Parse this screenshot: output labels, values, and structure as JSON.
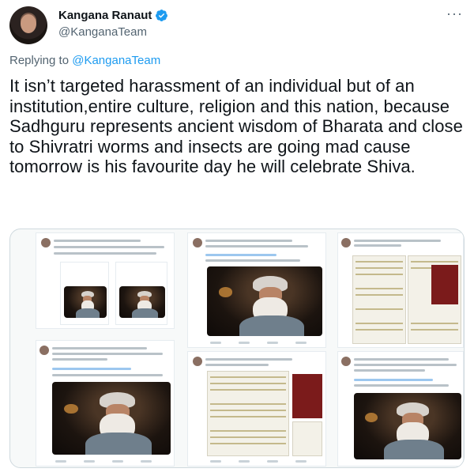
{
  "author": {
    "name": "Kangana Ranaut",
    "handle": "@KanganaTeam",
    "verified": true,
    "more_icon": "more-horizontal-icon"
  },
  "replying": {
    "prefix": "Replying to",
    "handle": "@KanganaTeam"
  },
  "tweet": {
    "text": "It isn’t targeted harassment of an individual but of an institution,entire culture, religion and this nation, because Sadhguru represents ancient wisdom of Bharata and close to Shivratri worms and insects are going mad cause tomorrow is his favourite day he will celebrate Shiva."
  },
  "colors": {
    "link": "#1d9bf0",
    "verified_badge": "#1d9bf0",
    "secondary_text": "#536471"
  }
}
